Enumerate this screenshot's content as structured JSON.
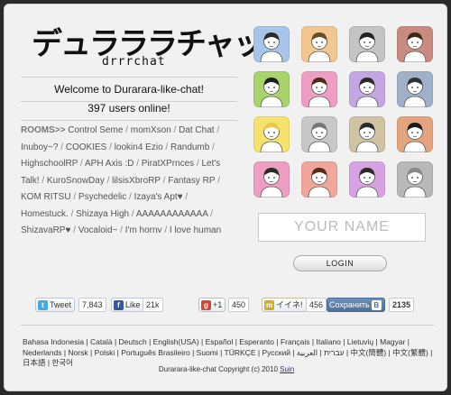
{
  "logo": {
    "main": "デュラララチャット",
    "sub": "drrrchat"
  },
  "welcome": "Welcome to Durarara-like-chat!",
  "online": "397 users online!",
  "rooms_label": "ROOMS>>",
  "rooms": [
    "Control Seme",
    "momXson",
    "Dat Chat",
    "Inuboy~?",
    "COOKIES",
    "lookin4 Ezio",
    "Randumb",
    "HighschoolRP",
    "APH Axis :D",
    "PiratXPrnces",
    "Let's Talk!",
    "KuroSnowDay",
    "lilsisXbroRP",
    "Fantasy RP",
    "KOM RITSU",
    "Psychedelic",
    "Izaya's Apt♥",
    "Homestuck.",
    "Shizaya High",
    "AAAAAAAAAAAA",
    "ShizayaRP♥",
    "Vocaloid~",
    "I'm horny",
    "I love human"
  ],
  "avatars": [
    {
      "name": "boy",
      "bg": "#a8c4e8"
    },
    {
      "name": "girl",
      "bg": "#f1c68f"
    },
    {
      "name": "headphones",
      "bg": "#c4c4c4"
    },
    {
      "name": "woman",
      "bg": "#c98a80"
    },
    {
      "name": "hat",
      "bg": "#a9d46c"
    },
    {
      "name": "pigtails",
      "bg": "#ee9ec3"
    },
    {
      "name": "braids",
      "bg": "#c4a6e3"
    },
    {
      "name": "sailor",
      "bg": "#9fb0c8"
    },
    {
      "name": "blond",
      "bg": "#f4e26c"
    },
    {
      "name": "gray",
      "bg": "#c8c8c8"
    },
    {
      "name": "suit",
      "bg": "#cfc3a4"
    },
    {
      "name": "geisha",
      "bg": "#e4a57e"
    },
    {
      "name": "bun",
      "bg": "#ee9ec3"
    },
    {
      "name": "curly",
      "bg": "#f0a69a"
    },
    {
      "name": "maid",
      "bg": "#d7a2e2"
    },
    {
      "name": "bald",
      "bg": "#b8b8b8"
    }
  ],
  "name_placeholder": "YOUR NAME",
  "login_label": "LOGIN",
  "social": {
    "tweet": {
      "label": "Tweet",
      "count": "7,843"
    },
    "like": {
      "label": "Like",
      "count": "21k"
    },
    "gplus": {
      "label": "+1",
      "count": "450"
    },
    "mixi": {
      "label": "イイネ!",
      "count": "456"
    },
    "vk": {
      "label": "Сохранить",
      "count": "2135"
    }
  },
  "languages": [
    "Bahasa Indonesia",
    "Català",
    "Deutsch",
    "English(USA)",
    "Español",
    "Esperanto",
    "Français",
    "Italiano",
    "Lietuvių",
    "Magyar",
    "Nederlands",
    "Norsk",
    "Polski",
    "Português Brasileiro",
    "Suomi",
    "TÜRKÇE",
    "Русский",
    "עברית",
    "العربية",
    "中文(簡體)",
    "中文(繁體)",
    "日本語",
    "한국어"
  ],
  "copyright_text": "Durarara-like-chat Copyright (c) 2010",
  "copyright_link": "Suin"
}
